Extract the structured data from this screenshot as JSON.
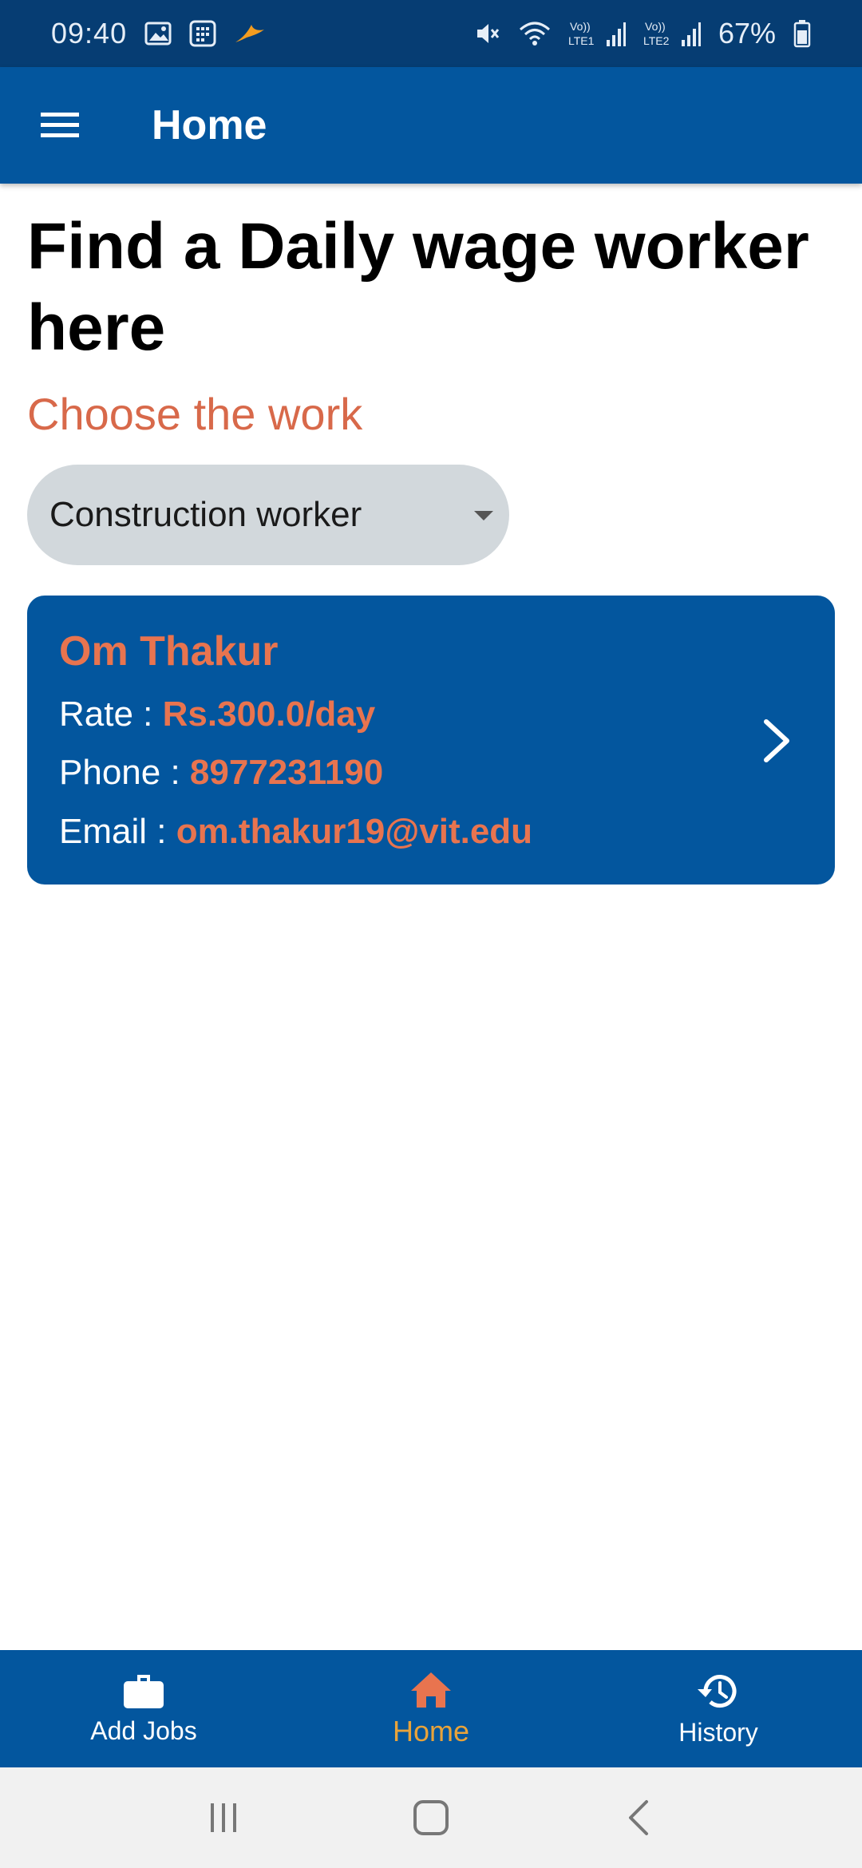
{
  "status_bar": {
    "time": "09:40",
    "battery": "67%",
    "icons": [
      "image-icon",
      "calculator-icon",
      "bird-icon",
      "mute-icon",
      "wifi-icon",
      "lte1-signal-icon",
      "lte2-signal-icon",
      "battery-icon"
    ],
    "lte1_label": "LTE1",
    "lte2_label": "LTE2",
    "volte_label": "Vo))"
  },
  "app_bar": {
    "title": "Home",
    "menu_icon": "hamburger-menu-icon"
  },
  "main": {
    "heading": "Find a Daily wage worker here",
    "subheading": "Choose the work",
    "work_select": {
      "value": "Construction worker"
    },
    "workers": [
      {
        "name": "Om Thakur",
        "rate_label": "Rate : ",
        "rate": "Rs.300.0/day",
        "phone_label": "Phone : ",
        "phone": "8977231190",
        "email_label": "Email : ",
        "email": "om.thakur19@vit.edu"
      }
    ]
  },
  "bottom_nav": {
    "items": [
      {
        "label": "Add Jobs",
        "icon": "briefcase-icon",
        "active": false
      },
      {
        "label": "Home",
        "icon": "home-icon",
        "active": true
      },
      {
        "label": "History",
        "icon": "history-icon",
        "active": false
      }
    ]
  },
  "colors": {
    "primary": "#03569e",
    "status_bar": "#063d73",
    "accent": "#e8744f",
    "active_nav": "#e8a33a",
    "dropdown_bg": "#d2d8dc"
  }
}
